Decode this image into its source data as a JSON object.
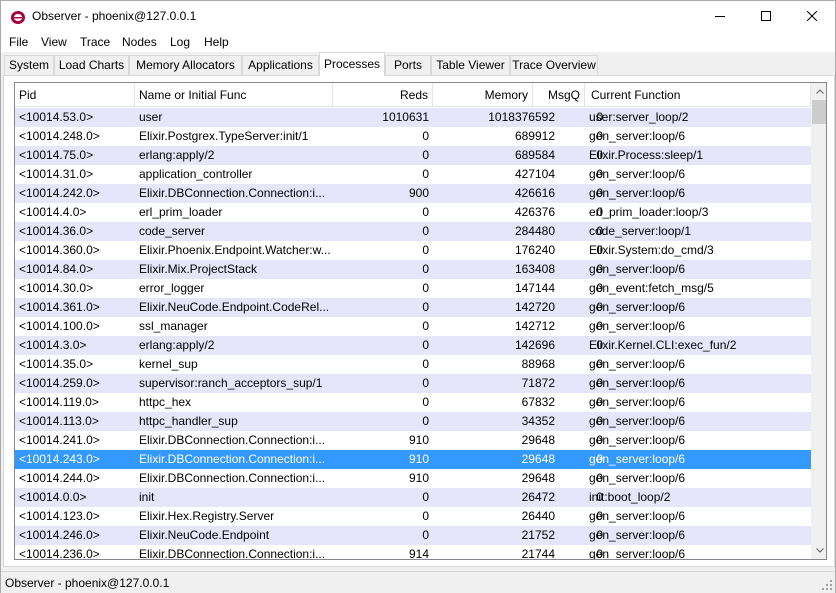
{
  "window": {
    "title": "Observer - phoenix@127.0.0.1",
    "minimize_icon": "minimize-icon",
    "maximize_icon": "maximize-icon",
    "close_icon": "close-icon"
  },
  "menu": [
    "File",
    "View",
    "Trace",
    "Nodes",
    "Log",
    "Help"
  ],
  "tabs": [
    "System",
    "Load Charts",
    "Memory Allocators",
    "Applications",
    "Processes",
    "Ports",
    "Table Viewer",
    "Trace Overview"
  ],
  "active_tab": "Processes",
  "columns": {
    "pid": "Pid",
    "name": "Name or Initial Func",
    "reds": "Reds",
    "memory": "Memory",
    "msgq": "MsgQ",
    "func": "Current Function"
  },
  "rows": [
    {
      "pid": "<10014.53.0>",
      "name": "user",
      "reds": "1010631",
      "memory": "1018376592",
      "msgq": "0",
      "func": "user:server_loop/2"
    },
    {
      "pid": "<10014.248.0>",
      "name": "Elixir.Postgrex.TypeServer:init/1",
      "reds": "0",
      "memory": "689912",
      "msgq": "0",
      "func": "gen_server:loop/6"
    },
    {
      "pid": "<10014.75.0>",
      "name": "erlang:apply/2",
      "reds": "0",
      "memory": "689584",
      "msgq": "0",
      "func": "Elixir.Process:sleep/1"
    },
    {
      "pid": "<10014.31.0>",
      "name": "application_controller",
      "reds": "0",
      "memory": "427104",
      "msgq": "0",
      "func": "gen_server:loop/6"
    },
    {
      "pid": "<10014.242.0>",
      "name": "Elixir.DBConnection.Connection:i...",
      "reds": "900",
      "memory": "426616",
      "msgq": "0",
      "func": "gen_server:loop/6"
    },
    {
      "pid": "<10014.4.0>",
      "name": "erl_prim_loader",
      "reds": "0",
      "memory": "426376",
      "msgq": "0",
      "func": "erl_prim_loader:loop/3"
    },
    {
      "pid": "<10014.36.0>",
      "name": "code_server",
      "reds": "0",
      "memory": "284480",
      "msgq": "0",
      "func": "code_server:loop/1"
    },
    {
      "pid": "<10014.360.0>",
      "name": "Elixir.Phoenix.Endpoint.Watcher:w...",
      "reds": "0",
      "memory": "176240",
      "msgq": "0",
      "func": "Elixir.System:do_cmd/3"
    },
    {
      "pid": "<10014.84.0>",
      "name": "Elixir.Mix.ProjectStack",
      "reds": "0",
      "memory": "163408",
      "msgq": "0",
      "func": "gen_server:loop/6"
    },
    {
      "pid": "<10014.30.0>",
      "name": "error_logger",
      "reds": "0",
      "memory": "147144",
      "msgq": "0",
      "func": "gen_event:fetch_msg/5"
    },
    {
      "pid": "<10014.361.0>",
      "name": "Elixir.NeuCode.Endpoint.CodeRel...",
      "reds": "0",
      "memory": "142720",
      "msgq": "0",
      "func": "gen_server:loop/6"
    },
    {
      "pid": "<10014.100.0>",
      "name": "ssl_manager",
      "reds": "0",
      "memory": "142712",
      "msgq": "0",
      "func": "gen_server:loop/6"
    },
    {
      "pid": "<10014.3.0>",
      "name": "erlang:apply/2",
      "reds": "0",
      "memory": "142696",
      "msgq": "0",
      "func": "Elixir.Kernel.CLI:exec_fun/2"
    },
    {
      "pid": "<10014.35.0>",
      "name": "kernel_sup",
      "reds": "0",
      "memory": "88968",
      "msgq": "0",
      "func": "gen_server:loop/6"
    },
    {
      "pid": "<10014.259.0>",
      "name": "supervisor:ranch_acceptors_sup/1",
      "reds": "0",
      "memory": "71872",
      "msgq": "0",
      "func": "gen_server:loop/6"
    },
    {
      "pid": "<10014.119.0>",
      "name": "httpc_hex",
      "reds": "0",
      "memory": "67832",
      "msgq": "0",
      "func": "gen_server:loop/6"
    },
    {
      "pid": "<10014.113.0>",
      "name": "httpc_handler_sup",
      "reds": "0",
      "memory": "34352",
      "msgq": "0",
      "func": "gen_server:loop/6"
    },
    {
      "pid": "<10014.241.0>",
      "name": "Elixir.DBConnection.Connection:i...",
      "reds": "910",
      "memory": "29648",
      "msgq": "0",
      "func": "gen_server:loop/6"
    },
    {
      "pid": "<10014.243.0>",
      "name": "Elixir.DBConnection.Connection:i...",
      "reds": "910",
      "memory": "29648",
      "msgq": "0",
      "func": "gen_server:loop/6"
    },
    {
      "pid": "<10014.244.0>",
      "name": "Elixir.DBConnection.Connection:i...",
      "reds": "910",
      "memory": "29648",
      "msgq": "0",
      "func": "gen_server:loop/6"
    },
    {
      "pid": "<10014.0.0>",
      "name": "init",
      "reds": "0",
      "memory": "26472",
      "msgq": "0",
      "func": "init:boot_loop/2"
    },
    {
      "pid": "<10014.123.0>",
      "name": "Elixir.Hex.Registry.Server",
      "reds": "0",
      "memory": "26440",
      "msgq": "0",
      "func": "gen_server:loop/6"
    },
    {
      "pid": "<10014.246.0>",
      "name": "Elixir.NeuCode.Endpoint",
      "reds": "0",
      "memory": "21752",
      "msgq": "0",
      "func": "gen_server:loop/6"
    },
    {
      "pid": "<10014.236.0>",
      "name": "Elixir.DBConnection.Connection:i...",
      "reds": "914",
      "memory": "21744",
      "msgq": "0",
      "func": "gen_server:loop/6"
    }
  ],
  "selected_row_index": 18,
  "status": "Observer - phoenix@127.0.0.1",
  "colors": {
    "row_alt": "#e6e6fa",
    "selection": "#3399ff"
  }
}
